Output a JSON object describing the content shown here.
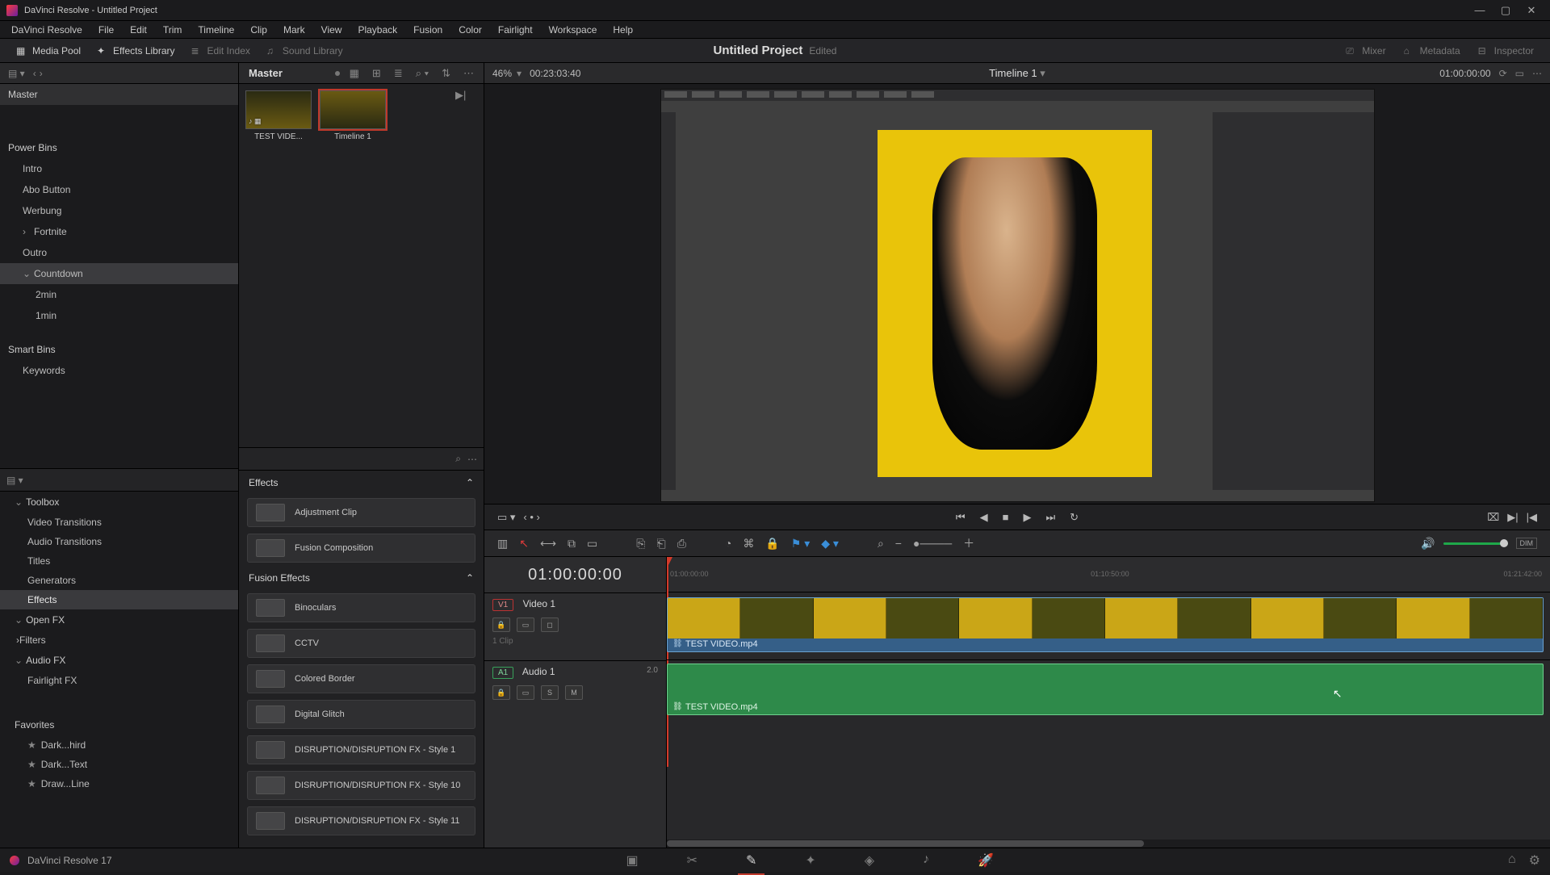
{
  "window_title": "DaVinci Resolve - Untitled Project",
  "menus": [
    "DaVinci Resolve",
    "File",
    "Edit",
    "Trim",
    "Timeline",
    "Clip",
    "Mark",
    "View",
    "Playback",
    "Fusion",
    "Color",
    "Fairlight",
    "Workspace",
    "Help"
  ],
  "toolbar": {
    "media_pool": "Media Pool",
    "effects_lib": "Effects Library",
    "edit_index": "Edit Index",
    "sound_lib": "Sound Library",
    "mixer": "Mixer",
    "metadata": "Metadata",
    "inspector": "Inspector"
  },
  "project": {
    "title": "Untitled Project",
    "status": "Edited"
  },
  "media_pool": {
    "breadcrumb": "Master",
    "zoom": "46%",
    "source_tc": "00:23:03:40",
    "clips": [
      {
        "name": "TEST VIDE...",
        "icons": "♪ ▦"
      },
      {
        "name": "Timeline 1",
        "icons": ""
      }
    ]
  },
  "bins": {
    "master": "Master",
    "power_bins": "Power Bins",
    "power_items": [
      "Intro",
      "Abo Button",
      "Werbung",
      "Fortnite",
      "Outro",
      "Countdown",
      "2min",
      "1min"
    ],
    "smart_bins": "Smart Bins",
    "smart_items": [
      "Keywords"
    ]
  },
  "effects_tree": {
    "toolbox": "Toolbox",
    "toolbox_items": [
      "Video Transitions",
      "Audio Transitions",
      "Titles",
      "Generators",
      "Effects"
    ],
    "openfx": "Open FX",
    "openfx_items": [
      "Filters"
    ],
    "audiofx": "Audio FX",
    "audiofx_items": [
      "Fairlight FX"
    ],
    "favorites": "Favorites",
    "fav_items": [
      "Dark...hird",
      "Dark...Text",
      "Draw...Line"
    ]
  },
  "fx_list": {
    "group1": "Effects",
    "group1_items": [
      "Adjustment Clip",
      "Fusion Composition"
    ],
    "group2": "Fusion Effects",
    "group2_items": [
      "Binoculars",
      "CCTV",
      "Colored Border",
      "Digital Glitch",
      "DISRUPTION/DISRUPTION FX - Style 1",
      "DISRUPTION/DISRUPTION FX - Style 10",
      "DISRUPTION/DISRUPTION FX - Style 11"
    ]
  },
  "viewer": {
    "timeline_name": "Timeline 1",
    "record_tc": "01:00:00:00"
  },
  "timeline": {
    "big_tc": "01:00:00:00",
    "ruler_labels": [
      "01:00:00:00",
      "01:10:50:00",
      "01:21:42:00"
    ],
    "video_track": {
      "badge": "V1",
      "name": "Video 1",
      "clip_info": "1 Clip",
      "clip_name": "TEST VIDEO.mp4"
    },
    "audio_track": {
      "badge": "A1",
      "name": "Audio 1",
      "meter": "2.0",
      "clip_name": "TEST VIDEO.mp4",
      "btn_s": "S",
      "btn_m": "M"
    }
  },
  "footer": {
    "version": "DaVinci Resolve 17"
  }
}
